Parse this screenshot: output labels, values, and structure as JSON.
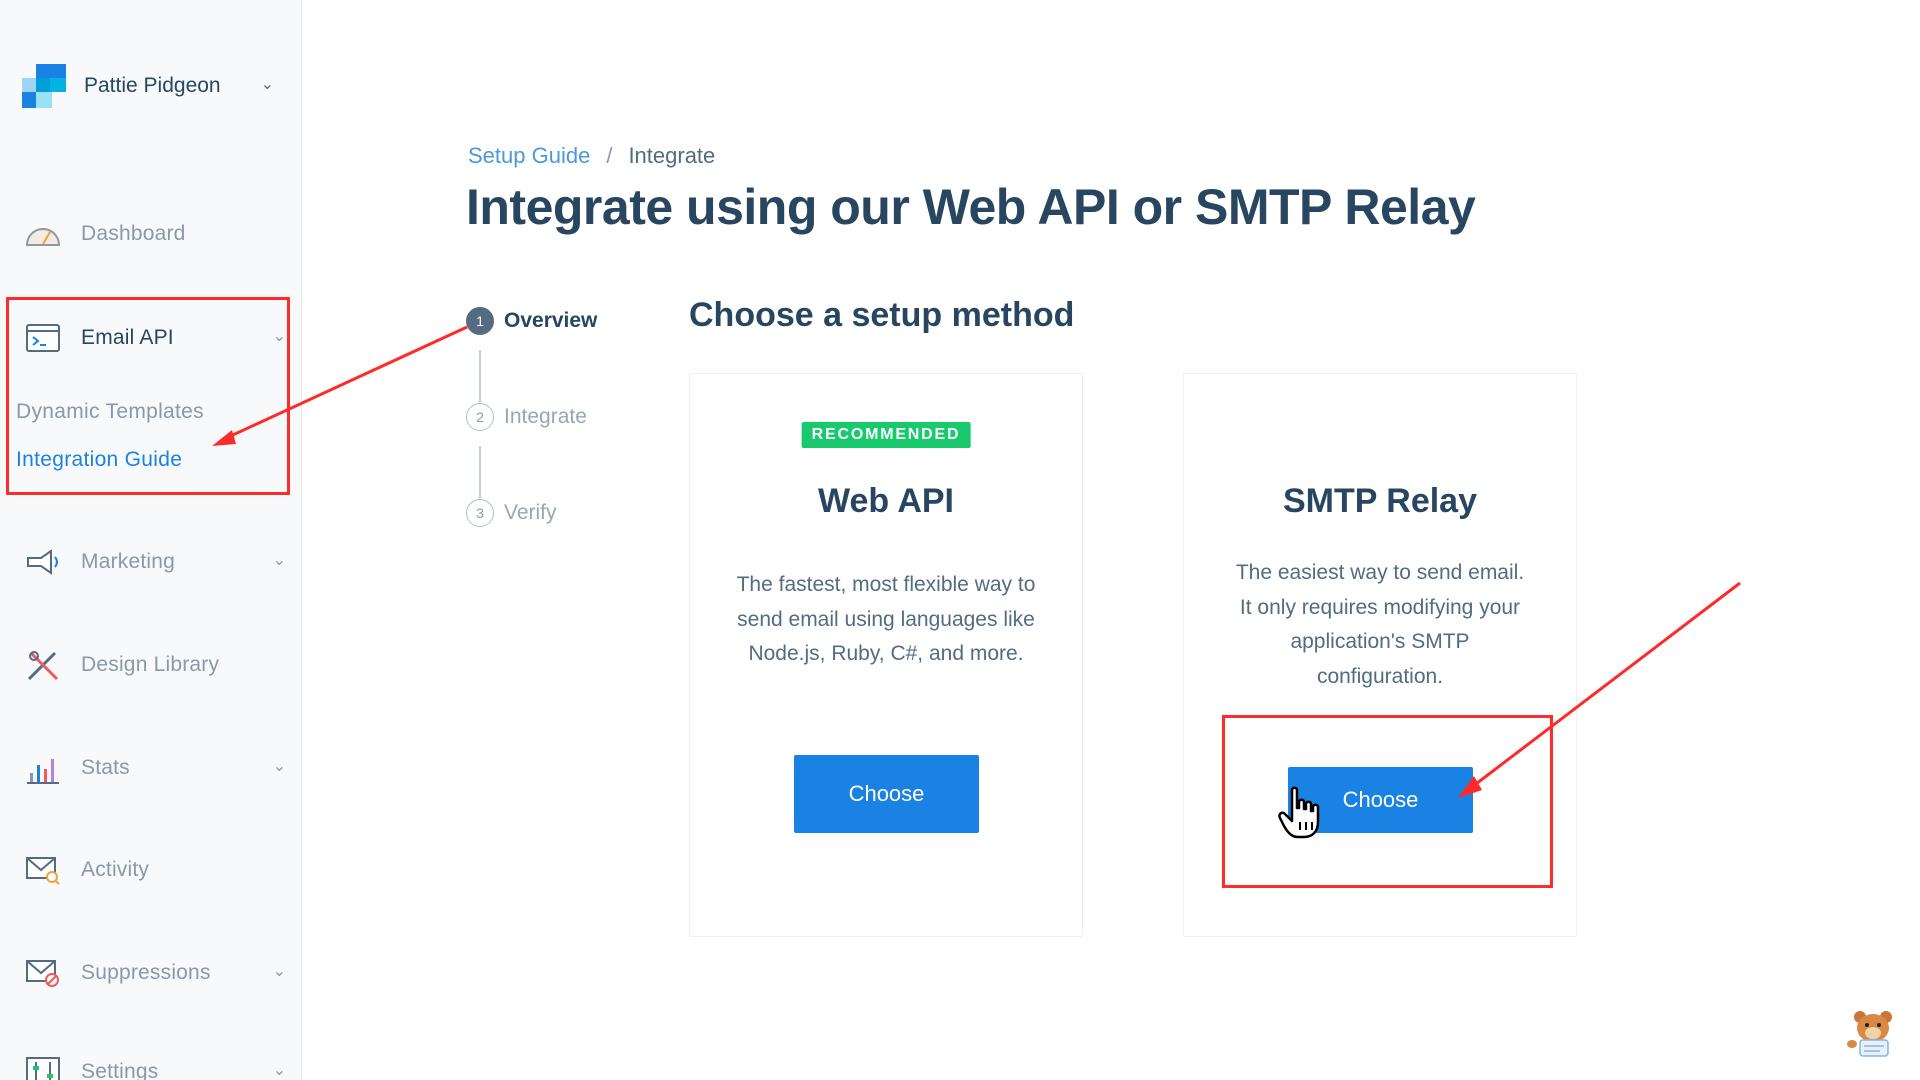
{
  "account": {
    "name": "Pattie Pidgeon"
  },
  "sidebar": {
    "items": [
      {
        "label": "Dashboard"
      },
      {
        "label": "Email API",
        "sub": [
          "Dynamic Templates",
          "Integration Guide"
        ]
      },
      {
        "label": "Marketing"
      },
      {
        "label": "Design Library"
      },
      {
        "label": "Stats"
      },
      {
        "label": "Activity"
      },
      {
        "label": "Suppressions"
      },
      {
        "label": "Settings"
      }
    ]
  },
  "breadcrumb": {
    "parent": "Setup Guide",
    "separator": "/",
    "current": "Integrate"
  },
  "page": {
    "title": "Integrate using our Web API or SMTP Relay"
  },
  "steps": [
    {
      "num": "1",
      "label": "Overview"
    },
    {
      "num": "2",
      "label": "Integrate"
    },
    {
      "num": "3",
      "label": "Verify"
    }
  ],
  "section": {
    "title": "Choose a setup method"
  },
  "cards": [
    {
      "badge": "RECOMMENDED",
      "title": "Web API",
      "description": "The fastest, most flexible way to send email using languages like Node.js, Ruby, C#, and more.",
      "button": "Choose"
    },
    {
      "title": "SMTP Relay",
      "description": "The easiest way to send email. It only requires modifying your application's SMTP configuration.",
      "button": "Choose"
    }
  ],
  "colors": {
    "accent": "#1a82e2",
    "recommended": "#18c96e",
    "annotation": "#ff2a2a",
    "text": "#294661"
  }
}
